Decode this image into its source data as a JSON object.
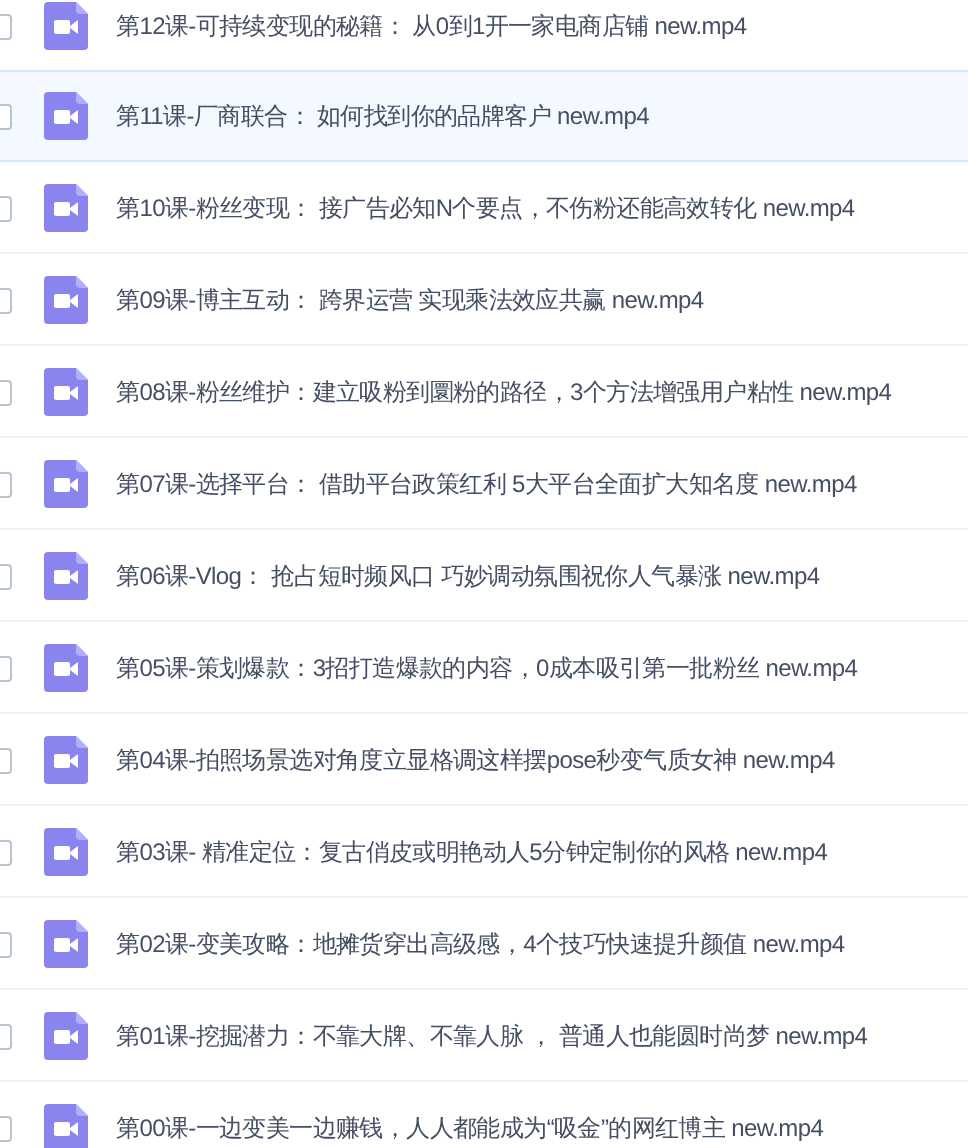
{
  "files": [
    {
      "name": "第12课-可持续变现的秘籍： 从0到1开一家电商店铺 new.mp4",
      "checked": false,
      "highlighted": false
    },
    {
      "name": "第11课-厂商联合： 如何找到你的品牌客户 new.mp4",
      "checked": false,
      "highlighted": true
    },
    {
      "name": "第10课-粉丝变现： 接广告必知N个要点，不伤粉还能高效转化 new.mp4",
      "checked": false,
      "highlighted": false
    },
    {
      "name": "第09课-博主互动： 跨界运营 实现乘法效应共赢 new.mp4",
      "checked": false,
      "highlighted": false
    },
    {
      "name": "第08课-粉丝维护：建立吸粉到圜粉的路径，3个方法增强用户粘性 new.mp4",
      "checked": false,
      "highlighted": false
    },
    {
      "name": "第07课-选择平台： 借助平台政策红利 5大平台全面扩大知名度 new.mp4",
      "checked": false,
      "highlighted": false
    },
    {
      "name": "第06课-Vlog： 抢占短时频风口 巧妙调动氛围祝你人气暴涨 new.mp4",
      "checked": false,
      "highlighted": false
    },
    {
      "name": "第05课-策划爆款：3招打造爆款的内容，0成本吸引第一批粉丝 new.mp4",
      "checked": false,
      "highlighted": false
    },
    {
      "name": "第04课-拍照场景选对角度立显格调这样摆pose秒变气质女神 new.mp4",
      "checked": false,
      "highlighted": false
    },
    {
      "name": "第03课- 精准定位：复古俏皮或明艳动人5分钟定制你的风格 new.mp4",
      "checked": false,
      "highlighted": false
    },
    {
      "name": "第02课-变美攻略：地摊货穿出高级感，4个技巧快速提升颜值 new.mp4",
      "checked": false,
      "highlighted": false
    },
    {
      "name": "第01课-挖掘潜力：不靠大牌、不靠人脉 ， 普通人也能圆时尚梦 new.mp4",
      "checked": false,
      "highlighted": false
    },
    {
      "name": "第00课-一边变美一边赚钱，人人都能成为“吸金”的网红博主 new.mp4",
      "checked": false,
      "highlighted": false
    }
  ]
}
